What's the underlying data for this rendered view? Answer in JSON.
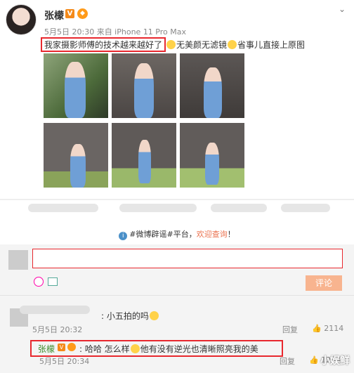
{
  "post": {
    "user_name": "张檬",
    "verified_badge": "V",
    "meta": "5月5日 20:30 来自 iPhone 11 Pro Max",
    "text_highlight": "我家摄影师傅的技术越来越好了",
    "text_rest": "无美颜无滤镜",
    "text_end": "省事儿直接上原图",
    "menu_icon": "chevron-down-icon",
    "photo_colors": {
      "wall": "#5a5552",
      "hydrangea": "#6f9fd6",
      "foliage": "#7a9a4a"
    }
  },
  "notice": {
    "prefix": "#微博辟谣#平台，",
    "link": "欢迎查询",
    "suffix": "！"
  },
  "compose": {
    "button_label": "评论"
  },
  "comments": [
    {
      "text": ": 小五拍的吗",
      "time": "5月5日 20:32",
      "reply_label": "回复",
      "like_count": "2114"
    }
  ],
  "reply": {
    "user_name": "张檬",
    "text_a": ": 哈哈 怎么样",
    "text_b": "他有没有逆光也清晰照亮我的美",
    "time": "5月5日 20:34",
    "reply_label": "回复",
    "like_count": "1234"
  },
  "watermark": "小娱鲜",
  "colors": {
    "highlight_box": "#e8282e",
    "link": "#eb7350",
    "comment_button": "#f8b48f",
    "username_green": "#3e8d2e"
  }
}
